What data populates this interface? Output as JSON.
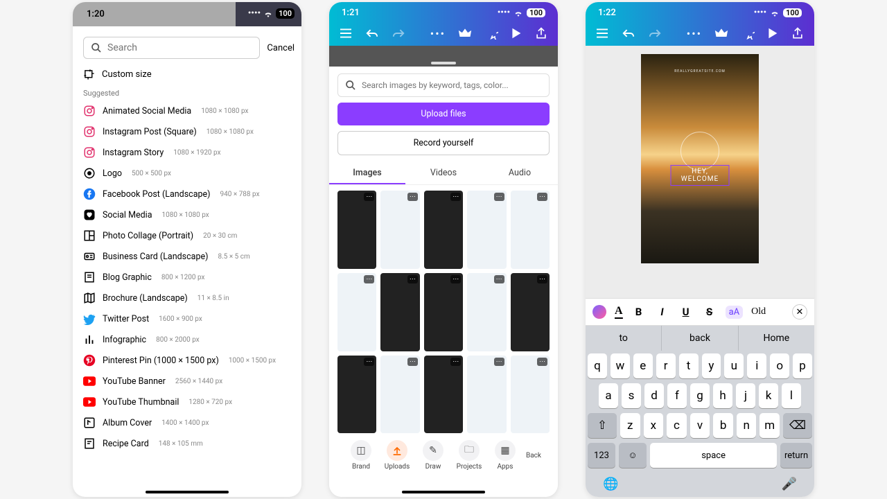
{
  "screen1": {
    "time": "1:20",
    "battery": "100",
    "search_placeholder": "Search",
    "cancel": "Cancel",
    "custom": "Custom size",
    "suggested": "Suggested",
    "items": [
      {
        "name": "Animated Social Media",
        "dim": "1080 × 1080 px",
        "ico": "ig"
      },
      {
        "name": "Instagram Post (Square)",
        "dim": "1080 × 1080 px",
        "ico": "ig"
      },
      {
        "name": "Instagram Story",
        "dim": "1080 × 1920 px",
        "ico": "ig"
      },
      {
        "name": "Logo",
        "dim": "500 × 500 px",
        "ico": "logo"
      },
      {
        "name": "Facebook Post (Landscape)",
        "dim": "940 × 788 px",
        "ico": "fb"
      },
      {
        "name": "Social Media",
        "dim": "1080 × 1080 px",
        "ico": "heart"
      },
      {
        "name": "Photo Collage (Portrait)",
        "dim": "20 × 30 cm",
        "ico": "collage"
      },
      {
        "name": "Business Card (Landscape)",
        "dim": "8.5 × 5 cm",
        "ico": "card"
      },
      {
        "name": "Blog Graphic",
        "dim": "800 × 1200 px",
        "ico": "blog"
      },
      {
        "name": "Brochure (Landscape)",
        "dim": "11 × 8.5 in",
        "ico": "brochure"
      },
      {
        "name": "Twitter Post",
        "dim": "1600 × 900 px",
        "ico": "tw"
      },
      {
        "name": "Infographic",
        "dim": "800 × 2000 px",
        "ico": "info"
      },
      {
        "name": "Pinterest Pin (1000 × 1500 px)",
        "dim": "1000 × 1500 px",
        "ico": "pin"
      },
      {
        "name": "YouTube Banner",
        "dim": "2560 × 1440 px",
        "ico": "yt"
      },
      {
        "name": "YouTube Thumbnail",
        "dim": "1280 × 720 px",
        "ico": "yt"
      },
      {
        "name": "Album Cover",
        "dim": "1400 × 1400 px",
        "ico": "album"
      },
      {
        "name": "Recipe Card",
        "dim": "148 × 105 mm",
        "ico": "recipe"
      }
    ]
  },
  "screen2": {
    "time": "1:21",
    "battery": "100",
    "search_placeholder": "Search images by keyword, tags, color...",
    "upload": "Upload files",
    "record": "Record yourself",
    "tabs": [
      "Images",
      "Videos",
      "Audio"
    ],
    "bottom": [
      "Brand",
      "Uploads",
      "Draw",
      "Projects",
      "Apps",
      "Back"
    ]
  },
  "screen3": {
    "time": "1:22",
    "battery": "100",
    "site": "REALLYGREATSITE.COM",
    "welcome": "HEY, WELCOME",
    "font_preview": "Old",
    "suggestions": [
      "to",
      "back",
      "Home"
    ],
    "rows": [
      [
        "q",
        "w",
        "e",
        "r",
        "t",
        "y",
        "u",
        "i",
        "o",
        "p"
      ],
      [
        "a",
        "s",
        "d",
        "f",
        "g",
        "h",
        "j",
        "k",
        "l"
      ],
      [
        "z",
        "x",
        "c",
        "v",
        "b",
        "n",
        "m"
      ]
    ],
    "numkey": "123",
    "space": "space",
    "return": "return"
  }
}
